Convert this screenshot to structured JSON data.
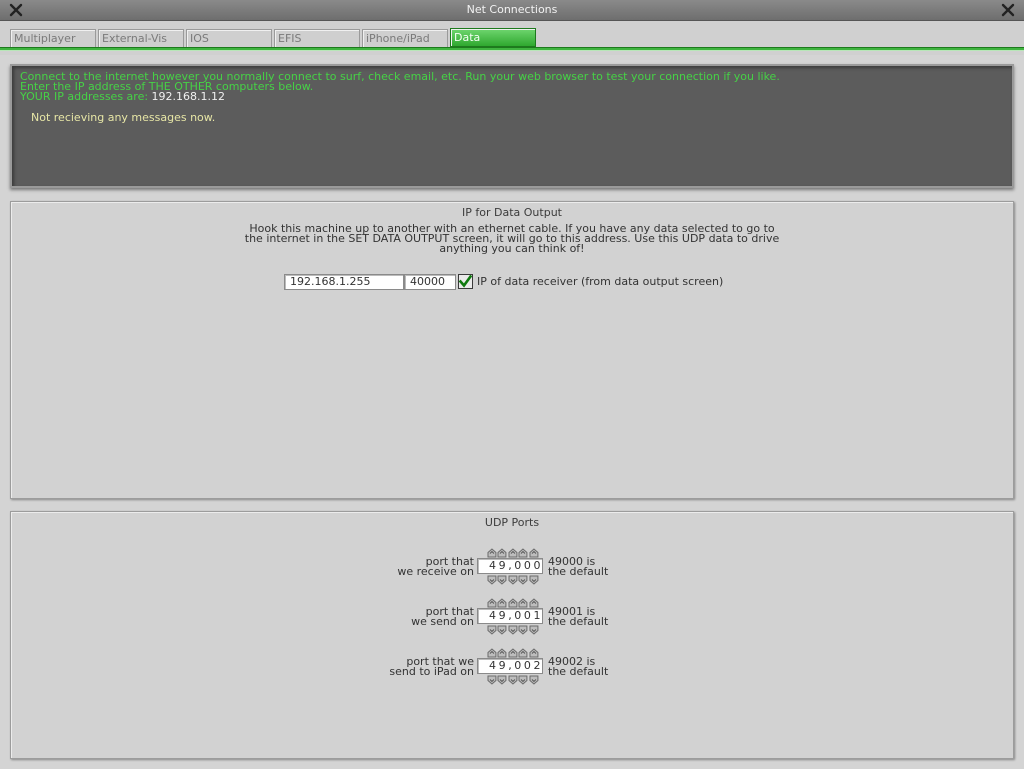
{
  "window": {
    "title": "Net Connections"
  },
  "tabs": [
    {
      "label": "Multiplayer"
    },
    {
      "label": "External-Vis"
    },
    {
      "label": "IOS"
    },
    {
      "label": "EFIS"
    },
    {
      "label": "iPhone/iPad"
    },
    {
      "label": "Data",
      "active": true
    }
  ],
  "info_panel": {
    "line1": "Connect to the internet however you normally connect to surf, check email, etc. Run your web browser to test your connection if you like.",
    "line2": "Enter the IP address of THE OTHER computers below.",
    "line3_label": "YOUR IP addresses are:",
    "line3_ip": "192.168.1.12",
    "status": "Not recieving any messages now."
  },
  "data_output": {
    "heading": "IP for Data Output",
    "desc_lines": [
      "Hook this machine up to another with an ethernet cable. If you have any data selected to go to",
      "the internet in the SET DATA OUTPUT screen, it will go to this address. Use this UDP data to drive",
      "anything you can think of!"
    ],
    "ip_value": "192.168.1.255",
    "port_value": "40000",
    "checkbox_checked": true,
    "checkbox_label": "IP of data receiver (from data output screen)"
  },
  "udp_ports": {
    "heading": "UDP Ports",
    "rows": [
      {
        "label_line1": "port that",
        "label_line2": "we receive on",
        "value": "49,000",
        "default_line1": "49000 is",
        "default_line2": "the default"
      },
      {
        "label_line1": "port that",
        "label_line2": "we send on",
        "value": "49,001",
        "default_line1": "49001 is",
        "default_line2": "the default"
      },
      {
        "label_line1": "port that we",
        "label_line2": "send to iPad on",
        "value": "49,002",
        "default_line1": "49002 is",
        "default_line2": "the default"
      }
    ]
  },
  "colors": {
    "accent_green": "#3fb43f",
    "info_text_green": "#46d246",
    "status_text_yellow": "#e7e6a6",
    "dark_panel": "#5c5c5c"
  },
  "icons": {
    "close": "close-x-icon",
    "checkbox": "checkmark-icon",
    "stepper_up": "stepper-up-arrow-icon",
    "stepper_down": "stepper-down-arrow-icon"
  }
}
